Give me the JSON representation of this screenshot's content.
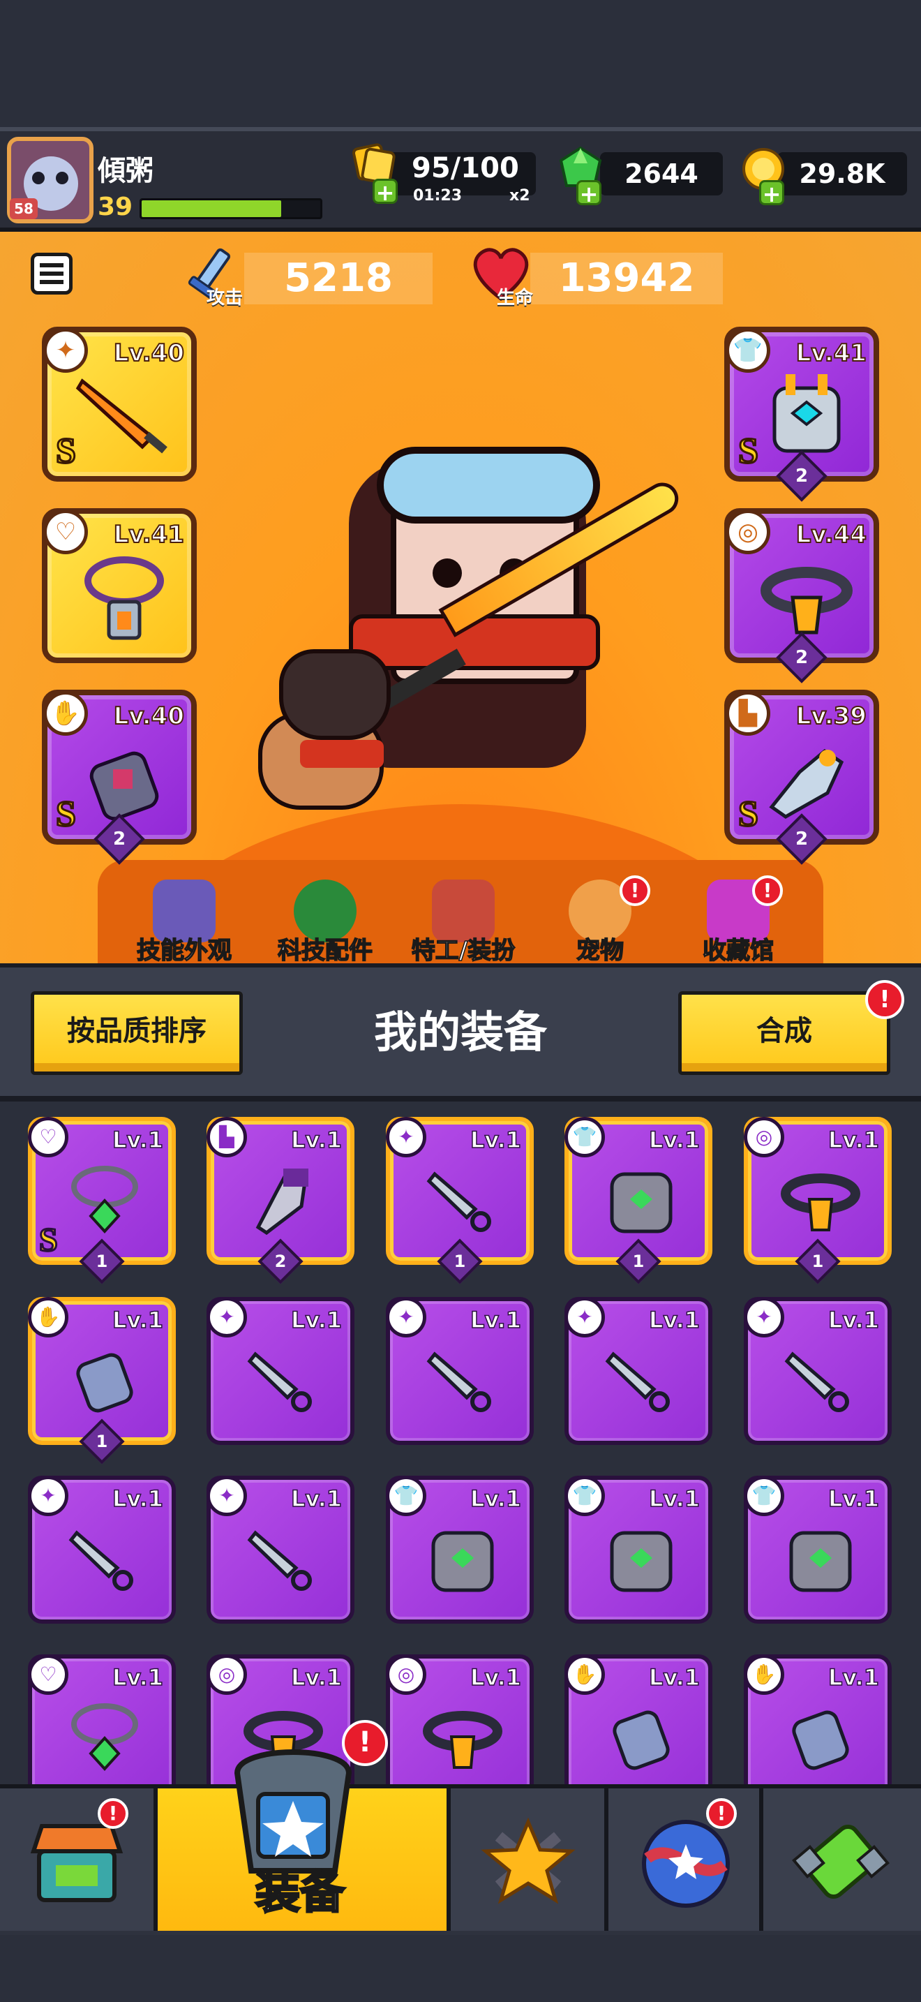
{
  "player": {
    "name": "傾粥",
    "level": "39",
    "avatar_badge": "58",
    "xp_fraction": 0.78
  },
  "resources": {
    "energy": {
      "value": "95/100",
      "timer": "01:23",
      "multiplier": "x2",
      "icon": "energy-icon"
    },
    "gems": {
      "value": "2644",
      "icon": "green-gem-icon"
    },
    "coins": {
      "value": "29.8K",
      "icon": "gold-coin-icon"
    }
  },
  "stats": {
    "attack": {
      "label": "攻击",
      "value": "5218",
      "icon": "sword-icon"
    },
    "health": {
      "label": "生命",
      "value": "13942",
      "icon": "heart-icon"
    }
  },
  "equipped": {
    "left": [
      {
        "slot": "weapon",
        "level": "Lv.40",
        "grade": "S",
        "color": "gold",
        "count": ""
      },
      {
        "slot": "necklace",
        "level": "Lv.41",
        "grade": "",
        "color": "gold",
        "count": ""
      },
      {
        "slot": "gloves",
        "level": "Lv.40",
        "grade": "S",
        "color": "purple",
        "count": "2"
      }
    ],
    "right": [
      {
        "slot": "armor",
        "level": "Lv.41",
        "grade": "S",
        "color": "purple",
        "count": "2"
      },
      {
        "slot": "belt",
        "level": "Lv.44",
        "grade": "",
        "color": "purple",
        "count": "2"
      },
      {
        "slot": "boots",
        "level": "Lv.39",
        "grade": "S",
        "color": "purple",
        "count": "2"
      }
    ]
  },
  "submenu": [
    {
      "label": "技能外观",
      "icon": "skill-skin-icon",
      "alert": false
    },
    {
      "label": "科技配件",
      "icon": "tech-parts-icon",
      "alert": false
    },
    {
      "label": "特工/装扮",
      "icon": "agent-outfit-icon",
      "alert": false
    },
    {
      "label": "宠物",
      "icon": "pet-icon",
      "alert": true
    },
    {
      "label": "收藏馆",
      "icon": "collection-icon",
      "alert": true
    }
  ],
  "equipment_panel": {
    "sort_button": "按品质排序",
    "title": "我的装备",
    "merge_button": "合成",
    "merge_alert": true
  },
  "inventory": [
    {
      "level": "Lv.1",
      "type": "necklace",
      "grade": "S",
      "count": "1",
      "gold": true
    },
    {
      "level": "Lv.1",
      "type": "boots",
      "grade": "",
      "count": "2",
      "gold": true
    },
    {
      "level": "Lv.1",
      "type": "weapon",
      "grade": "",
      "count": "1",
      "gold": true
    },
    {
      "level": "Lv.1",
      "type": "armor",
      "grade": "",
      "count": "1",
      "gold": true
    },
    {
      "level": "Lv.1",
      "type": "belt",
      "grade": "",
      "count": "1",
      "gold": true
    },
    {
      "level": "Lv.1",
      "type": "gloves",
      "grade": "",
      "count": "1",
      "gold": true
    },
    {
      "level": "Lv.1",
      "type": "weapon",
      "grade": "",
      "count": "",
      "gold": false
    },
    {
      "level": "Lv.1",
      "type": "weapon",
      "grade": "",
      "count": "",
      "gold": false
    },
    {
      "level": "Lv.1",
      "type": "weapon",
      "grade": "",
      "count": "",
      "gold": false
    },
    {
      "level": "Lv.1",
      "type": "weapon",
      "grade": "",
      "count": "",
      "gold": false
    },
    {
      "level": "Lv.1",
      "type": "weapon",
      "grade": "",
      "count": "",
      "gold": false
    },
    {
      "level": "Lv.1",
      "type": "weapon",
      "grade": "",
      "count": "",
      "gold": false
    },
    {
      "level": "Lv.1",
      "type": "armor",
      "grade": "",
      "count": "",
      "gold": false
    },
    {
      "level": "Lv.1",
      "type": "armor",
      "grade": "",
      "count": "",
      "gold": false
    },
    {
      "level": "Lv.1",
      "type": "armor",
      "grade": "",
      "count": "",
      "gold": false
    },
    {
      "level": "Lv.1",
      "type": "necklace",
      "grade": "",
      "count": "",
      "gold": false
    },
    {
      "level": "Lv.1",
      "type": "belt",
      "grade": "",
      "count": "",
      "gold": false
    },
    {
      "level": "Lv.1",
      "type": "belt",
      "grade": "",
      "count": "",
      "gold": false
    },
    {
      "level": "Lv.1",
      "type": "gloves",
      "grade": "",
      "count": "",
      "gold": false
    },
    {
      "level": "Lv.1",
      "type": "gloves",
      "grade": "",
      "count": "",
      "gold": false
    }
  ],
  "nav": {
    "tabs": [
      {
        "name": "shop",
        "icon": "shop-icon",
        "alert": true,
        "label": ""
      },
      {
        "name": "equipment",
        "icon": "equipment-icon",
        "alert": true,
        "label": "装备"
      },
      {
        "name": "battle",
        "icon": "battle-star-icon",
        "alert": false,
        "label": ""
      },
      {
        "name": "talents",
        "icon": "orb-icon",
        "alert": true,
        "label": ""
      },
      {
        "name": "dna",
        "icon": "dna-icon",
        "alert": false,
        "label": ""
      }
    ]
  },
  "colors": {
    "accent_yellow": "#ffd21a",
    "item_purple": "#9e3ae0",
    "arena_orange": "#ff9d1e",
    "alert_red": "#e81c2c"
  }
}
